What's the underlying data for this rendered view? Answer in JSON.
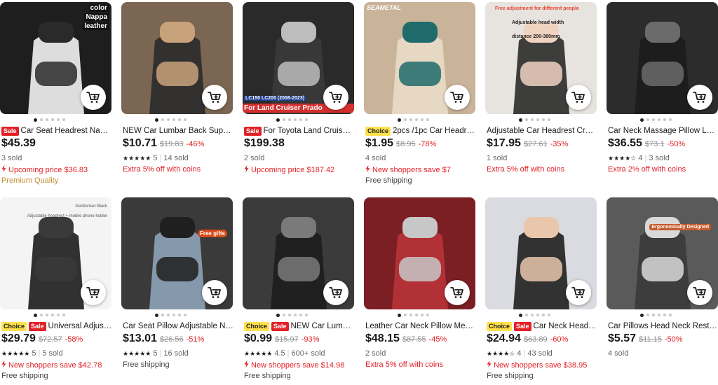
{
  "colors": {
    "sale_red": "#e22026",
    "choice_yellow": "#ffe14d",
    "premium_gold": "#c28a30",
    "text": "#191919",
    "muted": "#666666"
  },
  "products": [
    {
      "image_text": [
        "color",
        "Nappa",
        "leather"
      ],
      "tags": [
        "Sale"
      ],
      "title": "Car Seat Headrest Napp...",
      "price": "$45.39",
      "orig": "",
      "discount": "",
      "rating": "",
      "sold": "3 sold",
      "promo": "Upcoming price $36.83",
      "promo_icon": "bolt",
      "extra": "Premium Quality",
      "extra_type": "premium"
    },
    {
      "image_text": [],
      "tags": [],
      "title": "NEW Car Lumbar Back Suppo...",
      "price": "$10.71",
      "orig": "$19.83",
      "discount": "-46%",
      "rating": "5",
      "sold": "14 sold",
      "promo": "Extra 5% off with coins",
      "promo_icon": "",
      "extra": "",
      "extra_type": ""
    },
    {
      "image_text": [
        "LC150 LC200 (2008-2023)",
        "For Land Cruiser Prado"
      ],
      "tags": [
        "Sale"
      ],
      "title": "For Toyota Land Cruiser ...",
      "price": "$199.38",
      "orig": "",
      "discount": "",
      "rating": "",
      "sold": "2 sold",
      "promo": "Upcoming price $187.42",
      "promo_icon": "bolt",
      "extra": "",
      "extra_type": ""
    },
    {
      "image_text": [
        "SEAMETAL"
      ],
      "tags": [
        "Choice"
      ],
      "title": "2pcs /1pc Car Headrest...",
      "price": "$1.95",
      "orig": "$8.95",
      "discount": "-78%",
      "rating": "",
      "sold": "4 sold",
      "promo": "New shoppers save $7",
      "promo_icon": "bolt",
      "extra": "Free shipping",
      "extra_type": "ship"
    },
    {
      "image_text": [
        "Free adjustment for different people",
        "Adjustable head width",
        "distance 200-380mm"
      ],
      "tags": [],
      "title": "Adjustable Car Headrest Crea...",
      "price": "$17.95",
      "orig": "$27.61",
      "discount": "-35%",
      "rating": "",
      "sold": "1 sold",
      "promo": "Extra 5% off with coins",
      "promo_icon": "",
      "extra": "",
      "extra_type": ""
    },
    {
      "image_text": [],
      "tags": [],
      "title": "Car Neck Massage Pillow Lum...",
      "price": "$36.55",
      "orig": "$73.1",
      "discount": "-50%",
      "rating": "4",
      "sold": "3 sold",
      "promo": "Extra 2% off with coins",
      "promo_icon": "",
      "extra": "",
      "extra_type": ""
    },
    {
      "image_text": [
        "Gentleman Black",
        "Adjustable headrest + mobile phone holder"
      ],
      "tags": [
        "Choice",
        "Sale"
      ],
      "title": "Universal Adjustab...",
      "price": "$29.79",
      "orig": "$72.57",
      "discount": "-58%",
      "rating": "5",
      "sold": "5 sold",
      "promo": "New shoppers save $42.78",
      "promo_icon": "bolt",
      "extra": "Free shipping",
      "extra_type": "ship"
    },
    {
      "image_text": [
        "Free gifts"
      ],
      "tags": [],
      "title": "Car Seat Pillow Adjustable Ne...",
      "price": "$13.01",
      "orig": "$26.56",
      "discount": "-51%",
      "rating": "5",
      "sold": "16 sold",
      "promo": "Free shipping",
      "promo_icon": "",
      "promo_type": "ship",
      "extra": "",
      "extra_type": ""
    },
    {
      "image_text": [],
      "tags": [
        "Choice",
        "Sale"
      ],
      "title": "NEW Car Lumbar ...",
      "price": "$0.99",
      "orig": "$15.97",
      "discount": "-93%",
      "rating": "4.5",
      "sold": "600+ sold",
      "promo": "New shoppers save $14.98",
      "promo_icon": "bolt",
      "extra": "Free shipping",
      "extra_type": "ship"
    },
    {
      "image_text": [],
      "tags": [],
      "title": "Leather Car Neck Pillow Mem...",
      "price": "$48.15",
      "orig": "$87.55",
      "discount": "-45%",
      "rating": "",
      "sold": "2 sold",
      "promo": "Extra 5% off with coins",
      "promo_icon": "",
      "extra": "",
      "extra_type": ""
    },
    {
      "image_text": [],
      "tags": [
        "Choice",
        "Sale"
      ],
      "title": "Car Neck Headres...",
      "price": "$24.94",
      "orig": "$63.89",
      "discount": "-60%",
      "rating": "4",
      "sold": "43 sold",
      "promo": "New shoppers save $38.95",
      "promo_icon": "bolt",
      "extra": "Free shipping",
      "extra_type": "ship"
    },
    {
      "image_text": [
        "Ergonomically Designed"
      ],
      "tags": [],
      "title": "Car Pillows Head Neck Rest E...",
      "price": "$5.57",
      "orig": "$11.15",
      "discount": "-50%",
      "rating": "",
      "sold": "4 sold",
      "promo": "",
      "promo_icon": "",
      "extra": "",
      "extra_type": ""
    }
  ]
}
